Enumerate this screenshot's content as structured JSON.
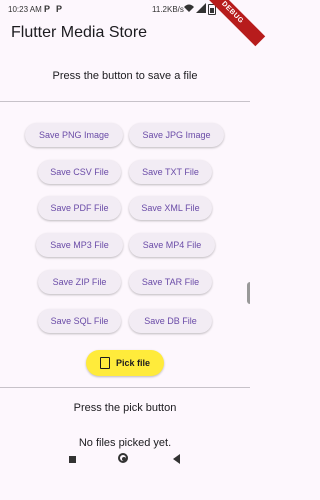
{
  "status_bar": {
    "time": "10:23 AM",
    "icon_p1": "P",
    "icon_p2": "P",
    "speed": "11.2KB/s"
  },
  "debug_banner": "DEBUG",
  "app": {
    "title": "Flutter Media Store"
  },
  "prompt_top": "Press the button to save a file",
  "save_buttons": [
    "Save PNG Image",
    "Save JPG Image",
    "Save CSV File",
    "Save TXT File",
    "Save PDF File",
    "Save XML File",
    "Save MP3 File",
    "Save MP4 File",
    "Save ZIP File",
    "Save TAR File",
    "Save SQL File",
    "Save DB File"
  ],
  "pick_button": {
    "label": "Pick file"
  },
  "prompt_bottom": "Press the pick button",
  "no_files": "No files picked yet.",
  "colors": {
    "background": "#fdf7fd",
    "button_bg": "#f2ecf4",
    "button_text": "#6a4ba7",
    "pick_bg": "#ffeb3b",
    "debug_banner": "#b71c1c"
  }
}
